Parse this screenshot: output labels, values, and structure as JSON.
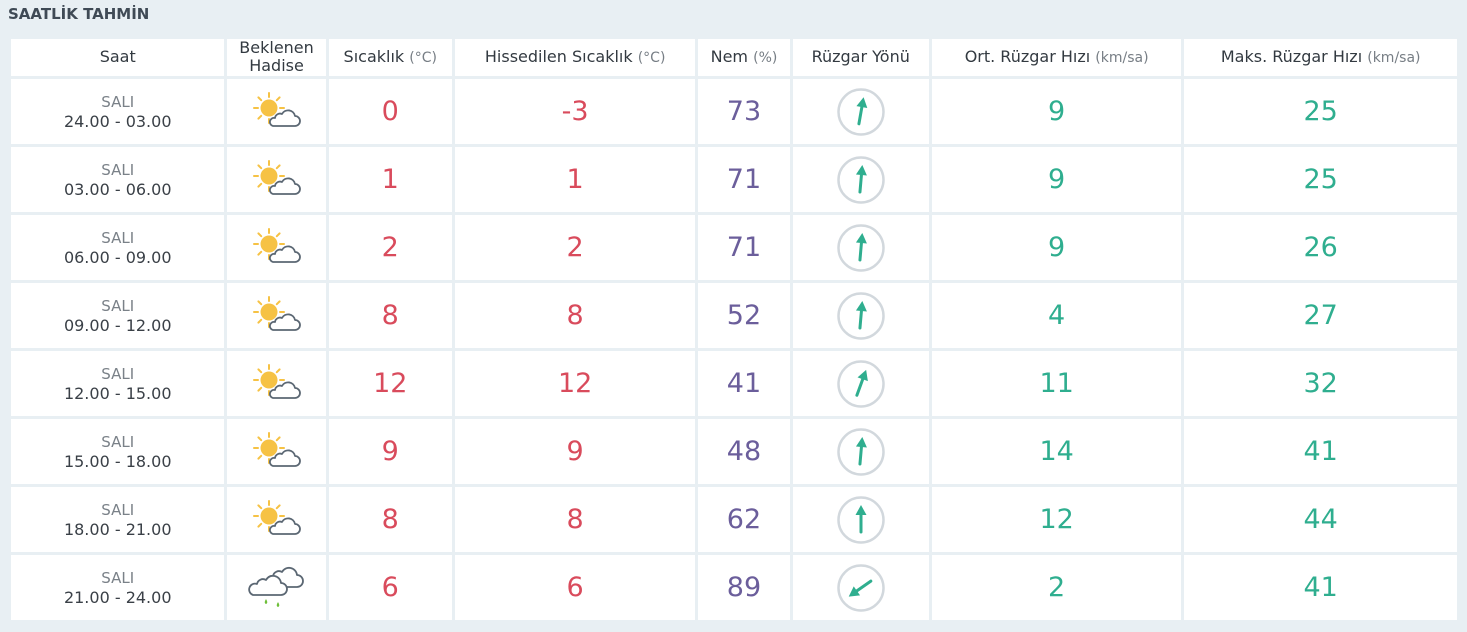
{
  "section": {
    "title": "SAATLİK TAHMİN"
  },
  "columns": [
    {
      "label": "Saat",
      "unit": ""
    },
    {
      "label": "Beklenen Hadise",
      "unit": ""
    },
    {
      "label": "Sıcaklık",
      "unit": "(°C)"
    },
    {
      "label": "Hissedilen Sıcaklık",
      "unit": "(°C)"
    },
    {
      "label": "Nem",
      "unit": "(%)"
    },
    {
      "label": "Rüzgar Yönü",
      "unit": ""
    },
    {
      "label": "Ort. Rüzgar Hızı",
      "unit": "(km/sa)"
    },
    {
      "label": "Maks. Rüzgar Hızı",
      "unit": "(km/sa)"
    }
  ],
  "icons": {
    "partly_cloudy": "partly-cloudy-icon",
    "rain": "rain-icon",
    "wind_arrow": "wind-direction-arrow-icon"
  },
  "colors": {
    "temperature": "#d94b5c",
    "humidity": "#6b5e9b",
    "wind": "#2fae8f",
    "sun": "#f6c244",
    "cloud": "#5b6773",
    "rain": "#6fbf3a"
  },
  "rows": [
    {
      "day": "SALI",
      "range": "24.00 - 03.00",
      "icon": "partly_cloudy",
      "temp": "0",
      "feels": "-3",
      "humidity": "73",
      "wind_dir_deg": 10,
      "avg_wind": "9",
      "max_wind": "25"
    },
    {
      "day": "SALI",
      "range": "03.00 - 06.00",
      "icon": "partly_cloudy",
      "temp": "1",
      "feels": "1",
      "humidity": "71",
      "wind_dir_deg": 5,
      "avg_wind": "9",
      "max_wind": "25"
    },
    {
      "day": "SALI",
      "range": "06.00 - 09.00",
      "icon": "partly_cloudy",
      "temp": "2",
      "feels": "2",
      "humidity": "71",
      "wind_dir_deg": 5,
      "avg_wind": "9",
      "max_wind": "26"
    },
    {
      "day": "SALI",
      "range": "09.00 - 12.00",
      "icon": "partly_cloudy",
      "temp": "8",
      "feels": "8",
      "humidity": "52",
      "wind_dir_deg": 5,
      "avg_wind": "4",
      "max_wind": "27"
    },
    {
      "day": "SALI",
      "range": "12.00 - 15.00",
      "icon": "partly_cloudy",
      "temp": "12",
      "feels": "12",
      "humidity": "41",
      "wind_dir_deg": 20,
      "avg_wind": "11",
      "max_wind": "32"
    },
    {
      "day": "SALI",
      "range": "15.00 - 18.00",
      "icon": "partly_cloudy",
      "temp": "9",
      "feels": "9",
      "humidity": "48",
      "wind_dir_deg": 5,
      "avg_wind": "14",
      "max_wind": "41"
    },
    {
      "day": "SALI",
      "range": "18.00 - 21.00",
      "icon": "partly_cloudy",
      "temp": "8",
      "feels": "8",
      "humidity": "62",
      "wind_dir_deg": 0,
      "avg_wind": "12",
      "max_wind": "44"
    },
    {
      "day": "SALI",
      "range": "21.00 - 24.00",
      "icon": "rain",
      "temp": "6",
      "feels": "6",
      "humidity": "89",
      "wind_dir_deg": 235,
      "avg_wind": "2",
      "max_wind": "41"
    }
  ]
}
